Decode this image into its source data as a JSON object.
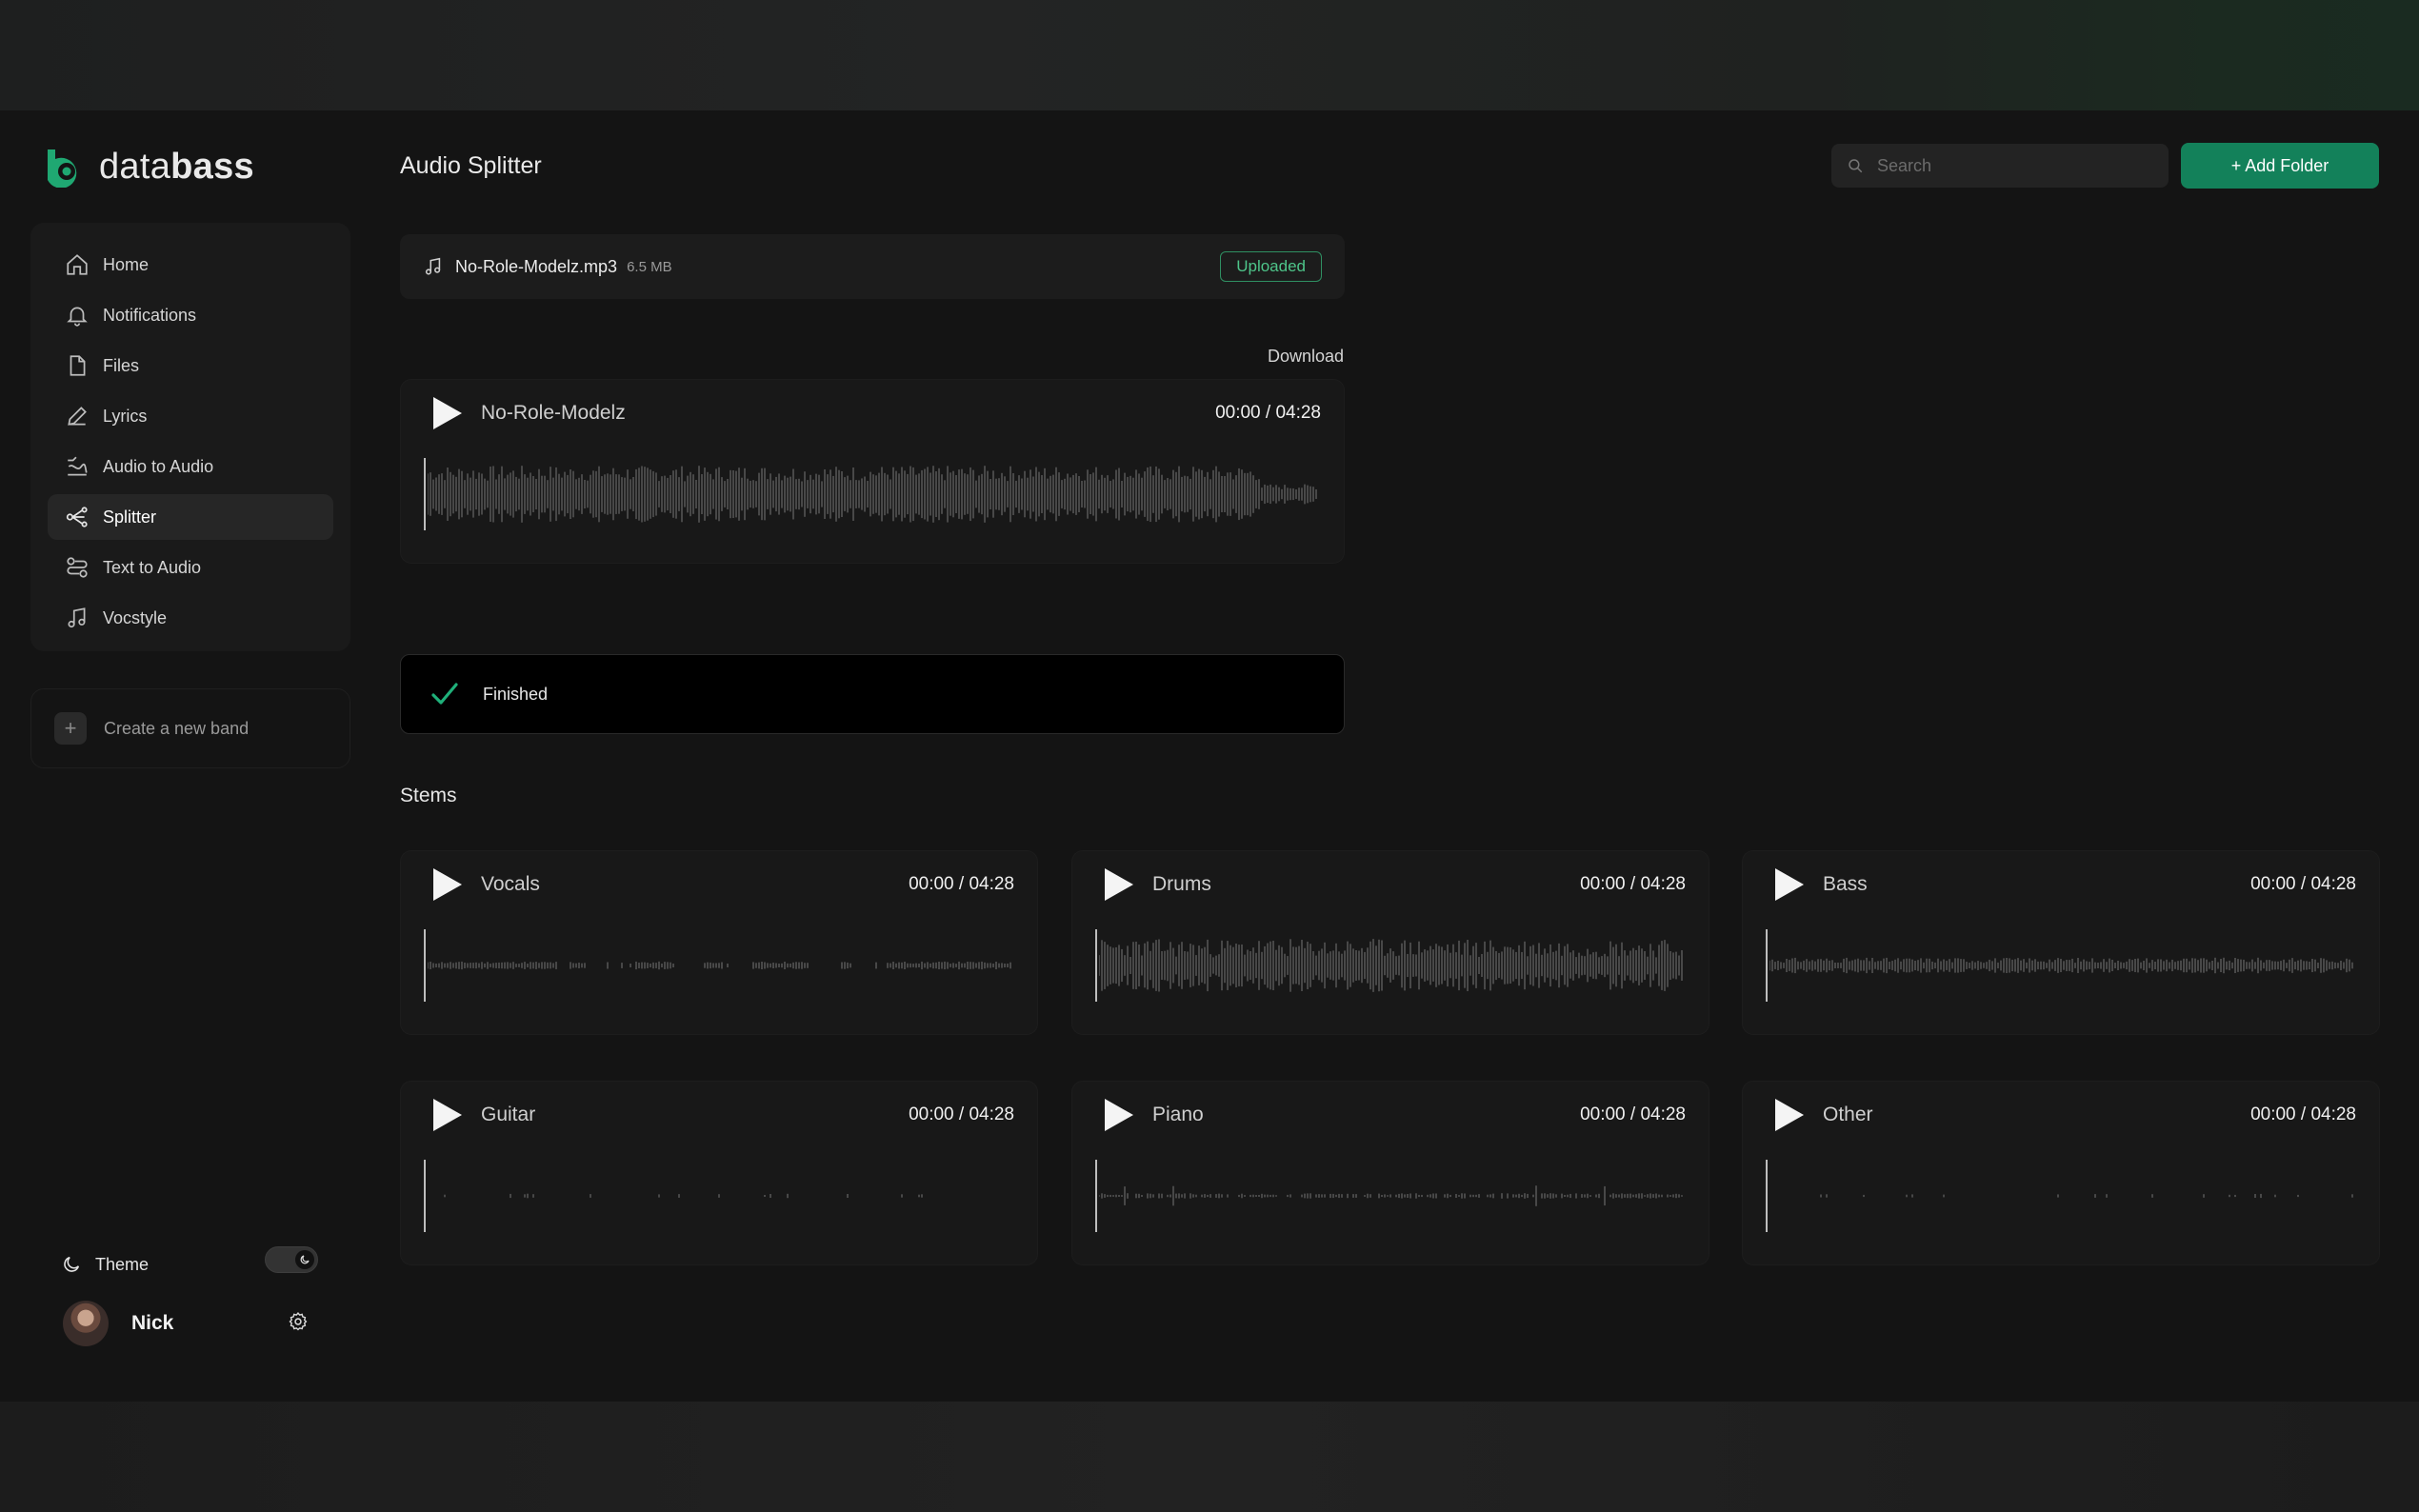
{
  "app": {
    "brand": {
      "prefix": "data",
      "suffix": "bass"
    },
    "page_title": "Audio Splitter"
  },
  "sidebar": {
    "items": [
      {
        "label": "Home",
        "icon": "home-icon"
      },
      {
        "label": "Notifications",
        "icon": "bell-icon"
      },
      {
        "label": "Files",
        "icon": "file-icon"
      },
      {
        "label": "Lyrics",
        "icon": "pencil-icon"
      },
      {
        "label": "Audio to Audio",
        "icon": "audio-to-audio-icon"
      },
      {
        "label": "Splitter",
        "icon": "splitter-icon",
        "active": true
      },
      {
        "label": "Text to Audio",
        "icon": "text-to-audio-icon"
      },
      {
        "label": "Vocstyle",
        "icon": "music-note-icon"
      }
    ],
    "create_band_label": "Create a new band",
    "theme_label": "Theme",
    "user_name": "Nick"
  },
  "header": {
    "search_placeholder": "Search",
    "add_folder_label": "+ Add Folder"
  },
  "upload": {
    "file_name": "No-Role-Modelz.mp3",
    "file_size": "6.5 MB",
    "status": "Uploaded"
  },
  "download_label": "Download",
  "main_player": {
    "title": "No-Role-Modelz",
    "time": "00:00 / 04:28"
  },
  "progress": {
    "status": "Finished"
  },
  "stems_title": "Stems",
  "stems": [
    {
      "name": "Vocals",
      "time": "00:00 / 04:28"
    },
    {
      "name": "Drums",
      "time": "00:00 / 04:28"
    },
    {
      "name": "Bass",
      "time": "00:00 / 04:28"
    },
    {
      "name": "Guitar",
      "time": "00:00 / 04:28"
    },
    {
      "name": "Piano",
      "time": "00:00 / 04:28"
    },
    {
      "name": "Other",
      "time": "00:00 / 04:28"
    }
  ],
  "colors": {
    "accent": "#13815a",
    "success": "#4ec58a",
    "background": "#141414",
    "card": "#181818"
  }
}
